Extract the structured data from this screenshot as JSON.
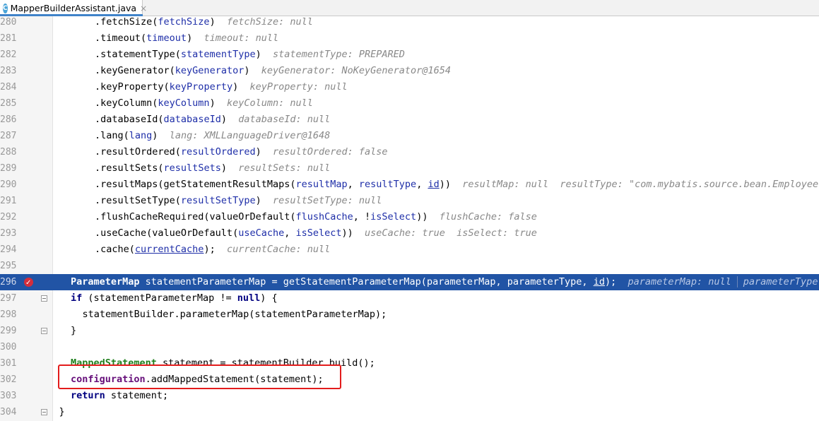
{
  "tab": {
    "title": "MapperBuilderAssistant.java",
    "icon": "C",
    "close": "×"
  },
  "lines": [
    {
      "n": "280",
      "indent": 2,
      "segs": [
        {
          "t": ".fetchSize("
        },
        {
          "t": "fetchSize",
          "c": "param"
        },
        {
          "t": ")"
        },
        {
          "t": "  fetchSize: null",
          "c": "hint"
        }
      ]
    },
    {
      "n": "281",
      "indent": 2,
      "segs": [
        {
          "t": ".timeout("
        },
        {
          "t": "timeout",
          "c": "param"
        },
        {
          "t": ")"
        },
        {
          "t": "  timeout: null",
          "c": "hint"
        }
      ]
    },
    {
      "n": "282",
      "indent": 2,
      "segs": [
        {
          "t": ".statementType("
        },
        {
          "t": "statementType",
          "c": "param"
        },
        {
          "t": ")"
        },
        {
          "t": "  statementType: PREPARED",
          "c": "hint"
        }
      ]
    },
    {
      "n": "283",
      "indent": 2,
      "segs": [
        {
          "t": ".keyGenerator("
        },
        {
          "t": "keyGenerator",
          "c": "param"
        },
        {
          "t": ")"
        },
        {
          "t": "  keyGenerator: NoKeyGenerator@1654",
          "c": "hint"
        }
      ]
    },
    {
      "n": "284",
      "indent": 2,
      "segs": [
        {
          "t": ".keyProperty("
        },
        {
          "t": "keyProperty",
          "c": "param"
        },
        {
          "t": ")"
        },
        {
          "t": "  keyProperty: null",
          "c": "hint"
        }
      ]
    },
    {
      "n": "285",
      "indent": 2,
      "segs": [
        {
          "t": ".keyColumn("
        },
        {
          "t": "keyColumn",
          "c": "param"
        },
        {
          "t": ")"
        },
        {
          "t": "  keyColumn: null",
          "c": "hint"
        }
      ]
    },
    {
      "n": "286",
      "indent": 2,
      "segs": [
        {
          "t": ".databaseId("
        },
        {
          "t": "databaseId",
          "c": "param"
        },
        {
          "t": ")"
        },
        {
          "t": "  databaseId: null",
          "c": "hint"
        }
      ]
    },
    {
      "n": "287",
      "indent": 2,
      "segs": [
        {
          "t": ".lang("
        },
        {
          "t": "lang",
          "c": "param"
        },
        {
          "t": ")"
        },
        {
          "t": "  lang: XMLLanguageDriver@1648",
          "c": "hint"
        }
      ]
    },
    {
      "n": "288",
      "indent": 2,
      "segs": [
        {
          "t": ".resultOrdered("
        },
        {
          "t": "resultOrdered",
          "c": "param"
        },
        {
          "t": ")"
        },
        {
          "t": "  resultOrdered: false",
          "c": "hint"
        }
      ]
    },
    {
      "n": "289",
      "indent": 2,
      "segs": [
        {
          "t": ".resultSets("
        },
        {
          "t": "resultSets",
          "c": "param"
        },
        {
          "t": ")"
        },
        {
          "t": "  resultSets: null",
          "c": "hint"
        }
      ]
    },
    {
      "n": "290",
      "indent": 2,
      "segs": [
        {
          "t": ".resultMaps(getStatementResultMaps("
        },
        {
          "t": "resultMap",
          "c": "param"
        },
        {
          "t": ", "
        },
        {
          "t": "resultType",
          "c": "param"
        },
        {
          "t": ", "
        },
        {
          "t": "id",
          "c": "param under"
        },
        {
          "t": "))"
        },
        {
          "t": "  resultMap: null  resultType: \"com.mybatis.source.bean.Employee\"",
          "c": "hint"
        }
      ]
    },
    {
      "n": "291",
      "indent": 2,
      "segs": [
        {
          "t": ".resultSetType("
        },
        {
          "t": "resultSetType",
          "c": "param"
        },
        {
          "t": ")"
        },
        {
          "t": "  resultSetType: null",
          "c": "hint"
        }
      ]
    },
    {
      "n": "292",
      "indent": 2,
      "segs": [
        {
          "t": ".flushCacheRequired(valueOrDefault("
        },
        {
          "t": "flushCache",
          "c": "param"
        },
        {
          "t": ", !"
        },
        {
          "t": "isSelect",
          "c": "param"
        },
        {
          "t": "))"
        },
        {
          "t": "  flushCache: false",
          "c": "hint"
        }
      ]
    },
    {
      "n": "293",
      "indent": 2,
      "segs": [
        {
          "t": ".useCache(valueOrDefault("
        },
        {
          "t": "useCache",
          "c": "param"
        },
        {
          "t": ", "
        },
        {
          "t": "isSelect",
          "c": "param"
        },
        {
          "t": "))"
        },
        {
          "t": "  useCache: true  isSelect: true",
          "c": "hint"
        }
      ]
    },
    {
      "n": "294",
      "indent": 2,
      "segs": [
        {
          "t": ".cache("
        },
        {
          "t": "currentCache",
          "c": "param under"
        },
        {
          "t": ");"
        },
        {
          "t": "  currentCache: null",
          "c": "hint"
        }
      ]
    },
    {
      "n": "295",
      "indent": 0,
      "segs": []
    },
    {
      "n": "296",
      "indent": 0,
      "hl": true,
      "bp": true,
      "segs": [
        {
          "t": "ParameterMap",
          "c": "typ"
        },
        {
          "t": " statementParameterMap = getStatementParameterMap("
        },
        {
          "t": "parameterMap",
          "c": "param"
        },
        {
          "t": ", "
        },
        {
          "t": "parameterType",
          "c": "param"
        },
        {
          "t": ", "
        },
        {
          "t": "id",
          "c": "param under"
        },
        {
          "t": ");"
        },
        {
          "t": "  parameterMap: null",
          "c": "hint"
        },
        {
          "sep": true
        },
        {
          "t": "parameterType: ",
          "c": "hint"
        }
      ]
    },
    {
      "n": "297",
      "indent": 0,
      "fold": true,
      "segs": [
        {
          "t": "if",
          "c": "kw"
        },
        {
          "t": " (statementParameterMap != "
        },
        {
          "t": "null",
          "c": "kw"
        },
        {
          "t": ") {"
        }
      ]
    },
    {
      "n": "298",
      "indent": 1,
      "segs": [
        {
          "t": "statementBuilder.parameterMap(statementParameterMap);"
        }
      ]
    },
    {
      "n": "299",
      "indent": 0,
      "fold": true,
      "segs": [
        {
          "t": "}"
        }
      ]
    },
    {
      "n": "300",
      "indent": 0,
      "segs": []
    },
    {
      "n": "301",
      "indent": 0,
      "segs": [
        {
          "t": "MappedStatement",
          "c": "typ"
        },
        {
          "t": " statement = statementBuilder.build();"
        }
      ]
    },
    {
      "n": "302",
      "indent": 0,
      "segs": [
        {
          "t": "configuration",
          "c": "fld"
        },
        {
          "t": ".addMappedStatement(statement);"
        }
      ]
    },
    {
      "n": "303",
      "indent": 0,
      "segs": [
        {
          "t": "return",
          "c": "kw"
        },
        {
          "t": " statement;"
        }
      ]
    },
    {
      "n": "304",
      "indent": -1,
      "fold": true,
      "segs": [
        {
          "t": "}"
        }
      ]
    }
  ]
}
